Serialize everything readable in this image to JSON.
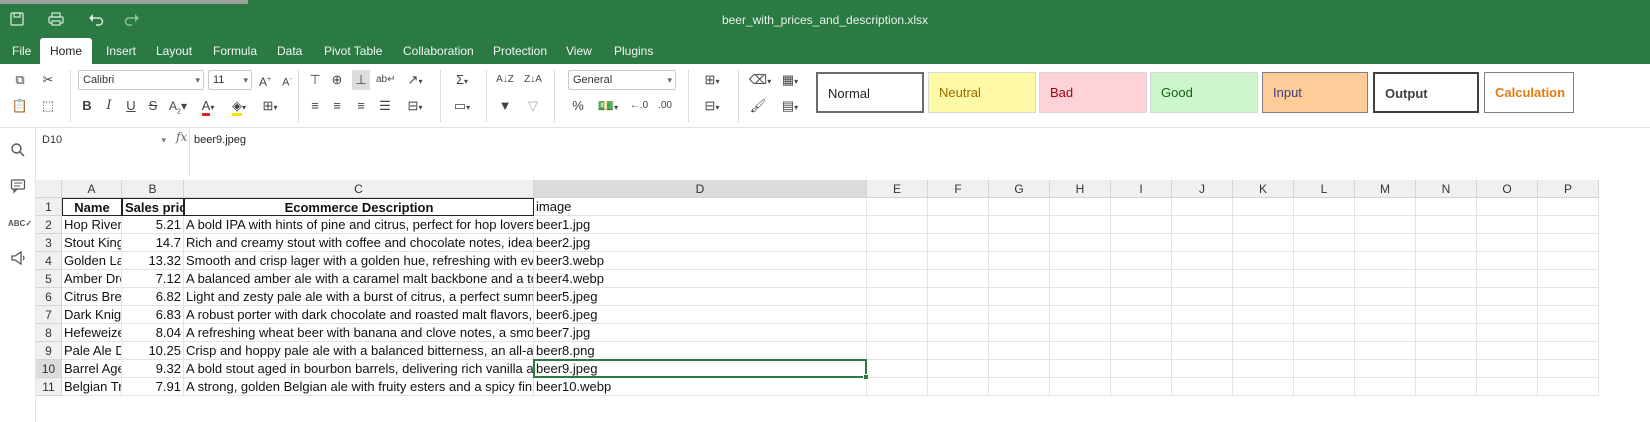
{
  "window": {
    "title": "beer_with_prices_and_description.xlsx",
    "quick_access": [
      {
        "name": "save-icon",
        "glyph": "🖫"
      },
      {
        "name": "print-icon",
        "glyph": "⎙"
      },
      {
        "name": "undo-icon",
        "glyph": "↶"
      },
      {
        "name": "redo-icon",
        "glyph": "↷"
      }
    ]
  },
  "menu": [
    "File",
    "Home",
    "Insert",
    "Layout",
    "Formula",
    "Data",
    "Pivot Table",
    "Collaboration",
    "Protection",
    "View",
    "Plugins"
  ],
  "menu_active": "Home",
  "toolbar": {
    "font_name": "Calibri",
    "font_size": "11",
    "number_format": "General",
    "cell_styles": [
      {
        "label": "Normal",
        "bg": "#ffffff",
        "fg": "#222222",
        "border": "#6b6b6b",
        "bold": false
      },
      {
        "label": "Neutral",
        "bg": "#fdf9a6",
        "fg": "#9b6a00",
        "border": "#d9d9d9",
        "bold": false
      },
      {
        "label": "Bad",
        "bg": "#fdd3d8",
        "fg": "#a40013",
        "border": "#d9d9d9",
        "bold": false
      },
      {
        "label": "Good",
        "bg": "#cdf6cd",
        "fg": "#15600e",
        "border": "#d9d9d9",
        "bold": false
      },
      {
        "label": "Input",
        "bg": "#fdcc99",
        "fg": "#3f3f76",
        "border": "#7f7f7f",
        "bold": false
      },
      {
        "label": "Output",
        "bg": "#ffffff",
        "fg": "#3f3f3f",
        "border": "#3f3f3f",
        "bold": true
      },
      {
        "label": "Calculation",
        "bg": "#ffffff",
        "fg": "#e27b0f",
        "border": "#7f7f7f",
        "bold": true
      }
    ]
  },
  "formula_bar": {
    "name_box": "D10",
    "fx_label": "fx",
    "content": "beer9.jpeg"
  },
  "left_rail": [
    {
      "name": "search-icon",
      "glyph": "⌕"
    },
    {
      "name": "comments-icon",
      "glyph": "🗨"
    },
    {
      "name": "spellcheck-icon",
      "glyph": "ᴬᴮᶜ"
    },
    {
      "name": "feedback-icon",
      "glyph": "📢"
    }
  ],
  "sheet": {
    "columns": [
      "A",
      "B",
      "C",
      "D",
      "E",
      "F",
      "G",
      "H",
      "I",
      "J",
      "K",
      "L",
      "M",
      "N",
      "O",
      "P"
    ],
    "selected_column": "D",
    "selected_row": 10,
    "header_row": [
      "Name",
      "Sales price",
      "Ecommerce Description",
      "image"
    ],
    "rows": [
      {
        "n": 2,
        "a": "Hop River",
        "b": "5.21",
        "c": "A bold IPA with hints of pine and citrus, perfect for hop lovers.",
        "d": "beer1.jpg"
      },
      {
        "n": 3,
        "a": "Stout King",
        "b": "14.7",
        "c": "Rich and creamy stout with coffee and chocolate notes, ideal f",
        "d": "beer2.jpg"
      },
      {
        "n": 4,
        "a": "Golden Lag",
        "b": "13.32",
        "c": "Smooth and crisp lager with a golden hue, refreshing with eve",
        "d": "beer3.webp"
      },
      {
        "n": 5,
        "a": "Amber Dre",
        "b": "7.12",
        "c": "A balanced amber ale with a caramel malt backbone and a tou",
        "d": "beer4.webp"
      },
      {
        "n": 6,
        "a": "Citrus Bree",
        "b": "6.82",
        "c": "Light and zesty pale ale with a burst of citrus, a perfect summe",
        "d": "beer5.jpeg"
      },
      {
        "n": 7,
        "a": "Dark Knigh",
        "b": "6.83",
        "c": "A robust porter with dark chocolate and roasted malt flavors,",
        "d": "beer6.jpeg"
      },
      {
        "n": 8,
        "a": "Hefeweize",
        "b": "8.04",
        "c": "A refreshing wheat beer with banana and clove notes, a smoo",
        "d": "beer7.jpg"
      },
      {
        "n": 9,
        "a": "Pale Ale De",
        "b": "10.25",
        "c": "Crisp and hoppy pale ale with a balanced bitterness, an all-aro",
        "d": "beer8.png"
      },
      {
        "n": 10,
        "a": "Barrel Agec",
        "b": "9.32",
        "c": "A bold stout aged in bourbon barrels, delivering rich vanilla ar",
        "d": "beer9.jpeg"
      },
      {
        "n": 11,
        "a": "Belgian Tri",
        "b": "7.91",
        "c": "A strong, golden Belgian ale with fruity esters and a spicy finisl",
        "d": "beer10.webp"
      }
    ]
  }
}
